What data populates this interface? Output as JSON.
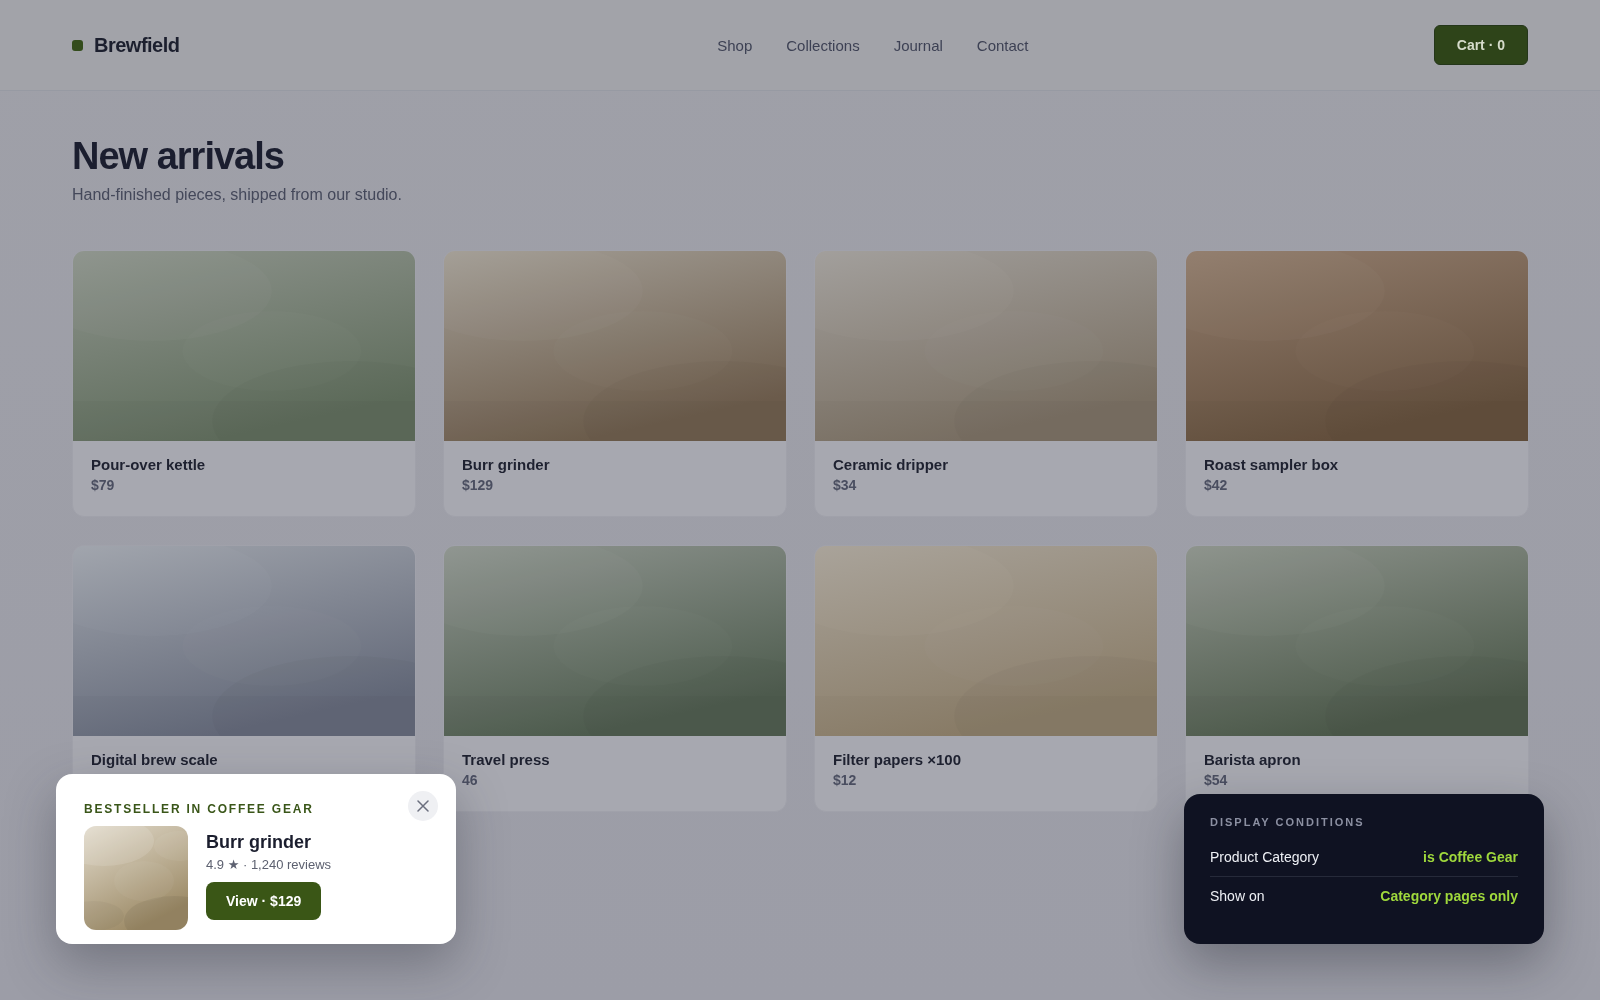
{
  "brand": {
    "name": "Brewfield"
  },
  "nav": [
    {
      "label": "Shop"
    },
    {
      "label": "Collections"
    },
    {
      "label": "Journal"
    },
    {
      "label": "Contact"
    }
  ],
  "cart": {
    "label": "Cart · 0"
  },
  "heading": {
    "title": "New arrivals",
    "subtitle": "Hand-finished pieces, shipped from our studio."
  },
  "products": [
    {
      "name": "Pour-over kettle",
      "price": "$79"
    },
    {
      "name": "Burr grinder",
      "price": "$129"
    },
    {
      "name": "Ceramic dripper",
      "price": "$34"
    },
    {
      "name": "Roast sampler box",
      "price": "$42"
    },
    {
      "name": "Digital brew scale"
    },
    {
      "name": "Travel press",
      "price": "46"
    },
    {
      "name": "Filter papers ×100",
      "price": "$12"
    },
    {
      "name": "Barista apron",
      "price": "$54"
    }
  ],
  "popup": {
    "eyebrow": "BESTSELLER IN COFFEE GEAR",
    "title": "Burr grinder",
    "rating": "4.9 ★ · 1,240 reviews",
    "button": "View · $129"
  },
  "conditions": {
    "title": "DISPLAY CONDITIONS",
    "rows": [
      {
        "label": "Product Category",
        "value": "is Coffee Gear"
      },
      {
        "label": "Show on",
        "value": "Category pages only"
      }
    ]
  }
}
